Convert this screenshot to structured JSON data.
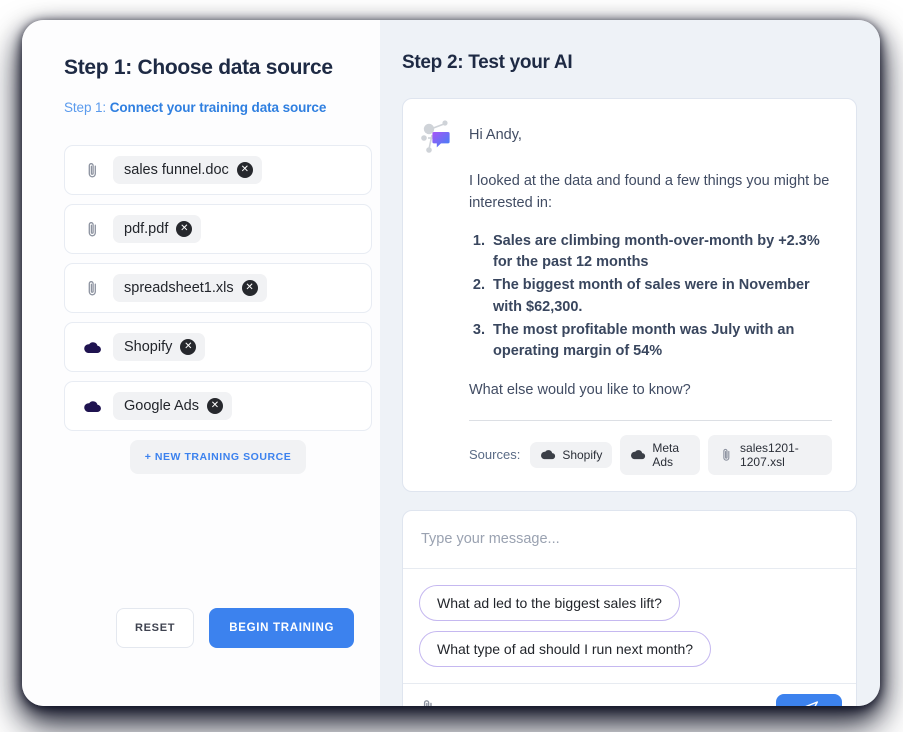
{
  "left": {
    "title": "Step 1: Choose data source",
    "subtitle_weak": "Step 1:",
    "subtitle_strong": "Connect your training data source",
    "sources": [
      {
        "icon": "paperclip-icon",
        "label": "sales funnel.doc"
      },
      {
        "icon": "paperclip-icon",
        "label": "pdf.pdf"
      },
      {
        "icon": "paperclip-icon",
        "label": "spreadsheet1.xls"
      },
      {
        "icon": "cloud-icon",
        "label": "Shopify"
      },
      {
        "icon": "cloud-icon",
        "label": "Google Ads"
      }
    ],
    "new_source_label": "+ NEW TRAINING SOURCE",
    "reset_label": "RESET",
    "begin_label": "BEGIN TRAINING"
  },
  "right": {
    "title": "Step 2: Test your AI",
    "message": {
      "greeting": "Hi Andy,",
      "intro": "I looked at the data and found a few things you might be interested in:",
      "facts": [
        "Sales are climbing month-over-month by +2.3% for the past 12 months",
        "The biggest month of sales were in November with $62,300.",
        "The most profitable month was July with an operating margin of 54%"
      ],
      "followup": "What else would you like to know?",
      "sources_label": "Sources:",
      "sources": [
        {
          "icon": "cloud-icon",
          "label": "Shopify"
        },
        {
          "icon": "cloud-icon",
          "label": "Meta Ads"
        },
        {
          "icon": "paperclip-icon",
          "label": "sales1201-1207.xsl"
        }
      ]
    },
    "composer": {
      "placeholder": "Type your message...",
      "value": "",
      "suggestions": [
        "What ad led to the biggest sales lift?",
        "What type of ad should I run next month?"
      ],
      "attach_icon": "paperclip-icon",
      "send_icon": "send-paper-plane-icon"
    }
  },
  "colors": {
    "accent_blue": "#3c82ee",
    "title_navy": "#1e2a44",
    "panel_bg": "#eef2f7",
    "suggestion_border": "#c5b8f0"
  }
}
